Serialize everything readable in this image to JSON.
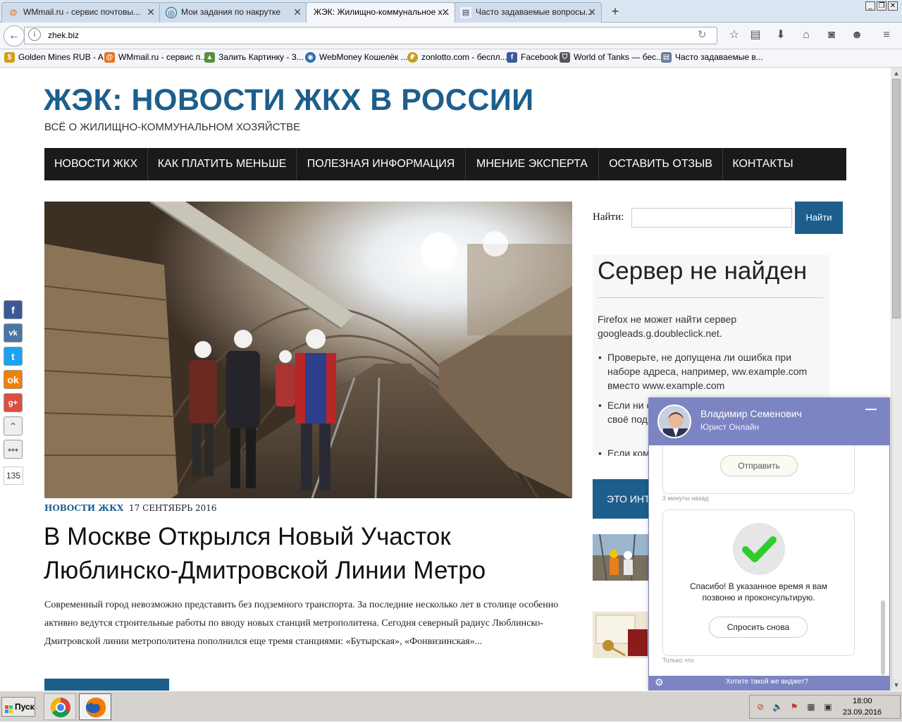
{
  "browser": {
    "tabs": [
      {
        "label": "WMmail.ru - сервис почтовы...",
        "icon": "wmmail-icon"
      },
      {
        "label": "Мои задания по накрутке",
        "icon": "spiral-icon"
      },
      {
        "label": "ЖЭК: Жилищно-коммунальное х...",
        "icon": "none"
      },
      {
        "label": "Часто задаваемые вопросы...",
        "icon": "document-icon"
      }
    ],
    "active_tab": 2,
    "new_tab": "+",
    "url": "zhek.biz",
    "bookmarks": [
      {
        "label": "Golden Mines RUB - A...",
        "icon": "coin-icon"
      },
      {
        "label": "WMmail.ru - сервис п...",
        "icon": "wmmail-icon"
      },
      {
        "label": "Залить Картинку - З...",
        "icon": "image-icon"
      },
      {
        "label": "WebMoney Кошелёк ...",
        "icon": "globe-icon"
      },
      {
        "label": "zonlotto.com - беспл...",
        "icon": "zonlotto-icon"
      },
      {
        "label": "Facebook",
        "icon": "facebook-icon"
      },
      {
        "label": "World of Tanks — бес...",
        "icon": "shield-icon"
      },
      {
        "label": "Часто задаваемые в...",
        "icon": "document-icon"
      }
    ]
  },
  "site": {
    "title": "ЖЭК: НОВОСТИ ЖКХ В РОССИИ",
    "tagline": "ВСЁ О ЖИЛИЩНО-КОММУНАЛЬНОМ ХОЗЯЙСТВЕ",
    "nav": [
      "НОВОСТИ ЖКХ",
      "КАК ПЛАТИТЬ МЕНЬШЕ",
      "ПОЛЕЗНАЯ ИНФОРМАЦИЯ",
      "МНЕНИЕ ЭКСПЕРТА",
      "ОСТАВИТЬ ОТЗЫВ",
      "КОНТАКТЫ"
    ]
  },
  "post": {
    "category": "НОВОСТИ ЖКХ",
    "date": "17 СЕНТЯБРЬ 2016",
    "title": "В Москве Открылся Новый Участок Люблинско-Дмитровской Линии Метро",
    "excerpt": "Современный город невозможно представить без подземного транспорта. За последние несколько лет в столице особенно активно ведутся строительные работы по вводу новых станций метрополитена. Сегодня северный радиус Люблинско-Дмитровской линии метрополитена пополнился еще тремя станциями: «Бутырская», «Фонвизинская»..."
  },
  "sidebar": {
    "search_label": "Найти:",
    "search_button": "Найти",
    "search_value": "",
    "error": {
      "title": "Сервер не найден",
      "message": "Firefox не может найти сервер googleads.g.doubleclick.net.",
      "items": [
        "Проверьте, не допущена ли ошибка при наборе адреса, например, ww.example.com вместо www.example.com",
        "Если ни один сайт не открывается, проверьте своё подключение к Интернету.",
        "Если компьютер"
      ]
    },
    "interesting_label": "ЭТО ИНТЕРЕСНО"
  },
  "social": {
    "buttons": [
      "f",
      "vk",
      "t",
      "ok",
      "g+",
      "up",
      "more"
    ],
    "count": "135"
  },
  "chat": {
    "agent_name": "Владимир Семенович",
    "agent_role": "Юрист Онлайн",
    "send_button": "Отправить",
    "time_ago": "3 минуты назад",
    "thanks_text": "Спасибо! В указанное время я вам позвоню и проконсультирую.",
    "ask_again_button": "Спросить снова",
    "just_now": "Только что",
    "footer_link": "Хотите такой же виджет?"
  },
  "taskbar": {
    "start": "Пуск",
    "time": "18:00",
    "date": "23.09.2016"
  },
  "colors": {
    "brand_blue": "#1d5e8c",
    "nav_bg": "#1a1a1a",
    "chat_header": "#7d84c2",
    "check_green": "#2ecc2e"
  }
}
